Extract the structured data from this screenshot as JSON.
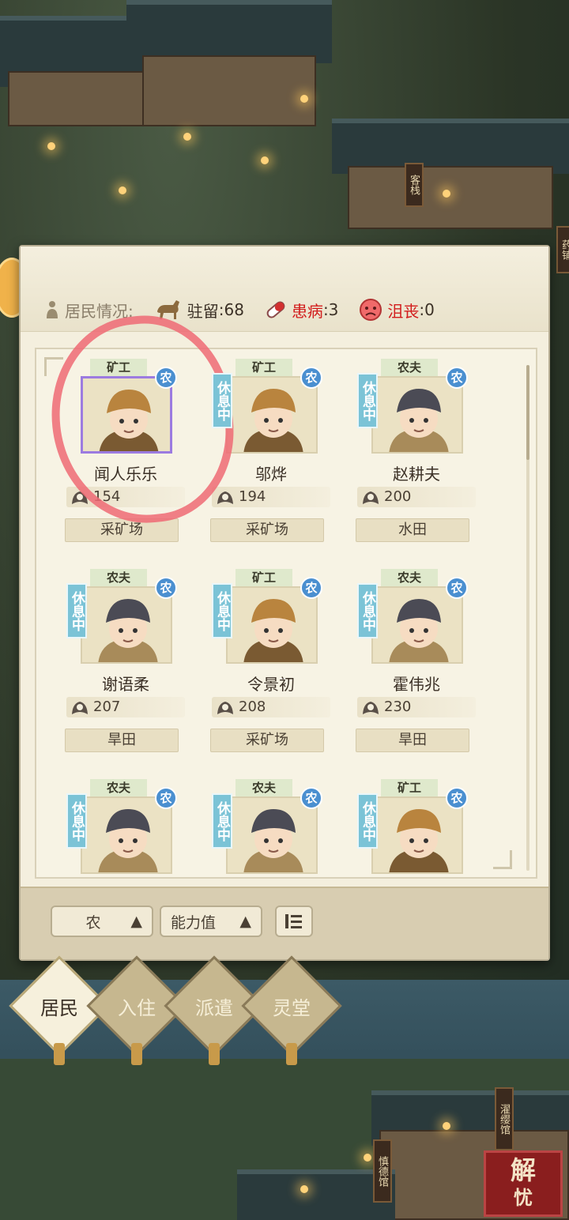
{
  "map": {
    "signs": [
      {
        "id": "inn",
        "text": "客栈"
      },
      {
        "id": "pharmacy",
        "text": "药铺"
      },
      {
        "id": "tailor",
        "text": "濯缨馆"
      },
      {
        "id": "virtue",
        "text": "慎德馆"
      }
    ]
  },
  "panel": {
    "residents_label": "居民情况:",
    "stats": {
      "stay_label": "驻留",
      "stay_value": ":68",
      "sick_label": "患病",
      "sick_value": ":3",
      "depressed_label": "沮丧",
      "depressed_value": ":0"
    },
    "residents": [
      {
        "role": "矿工",
        "name": "闻人乐乐",
        "score": "154",
        "place": "采矿场",
        "resting": false,
        "badge": "农"
      },
      {
        "role": "矿工",
        "name": "邬烨",
        "score": "194",
        "place": "采矿场",
        "resting": true,
        "badge": "农"
      },
      {
        "role": "农夫",
        "name": "赵耕夫",
        "score": "200",
        "place": "水田",
        "resting": true,
        "badge": "农"
      },
      {
        "role": "农夫",
        "name": "谢语柔",
        "score": "207",
        "place": "旱田",
        "resting": true,
        "badge": "农"
      },
      {
        "role": "矿工",
        "name": "令景初",
        "score": "208",
        "place": "采矿场",
        "resting": true,
        "badge": "农"
      },
      {
        "role": "农夫",
        "name": "霍伟兆",
        "score": "230",
        "place": "旱田",
        "resting": true,
        "badge": "农"
      },
      {
        "role": "农夫",
        "name": "",
        "score": "",
        "place": "",
        "resting": true,
        "badge": "农"
      },
      {
        "role": "农夫",
        "name": "",
        "score": "",
        "place": "",
        "resting": true,
        "badge": "农"
      },
      {
        "role": "矿工",
        "name": "",
        "score": "",
        "place": "",
        "resting": true,
        "badge": "农"
      }
    ],
    "rest_text": "休息中",
    "footer": {
      "filter_label": "农",
      "sort_label": "能力值"
    }
  },
  "tabs": [
    {
      "label": "居民",
      "active": true
    },
    {
      "label": "入住",
      "active": false
    },
    {
      "label": "派遣",
      "active": false
    },
    {
      "label": "灵堂",
      "active": false
    }
  ],
  "brand": {
    "line1": "解",
    "line2": "忧"
  },
  "colors": {
    "accent_red": "#d21c1c",
    "panel": "#f4efde",
    "badge_blue": "#4a8fd0",
    "rest_blue": "#7bc3d6",
    "highlight": "#ee6a74"
  }
}
